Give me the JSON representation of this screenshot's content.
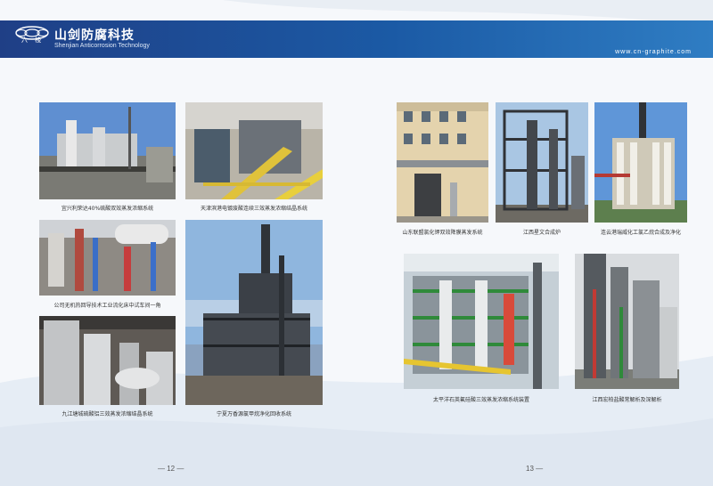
{
  "header": {
    "logo_text": "六 棱",
    "brand_cn": "山剑防腐科技",
    "brand_en": "Shenjian Anticorrosion Technology",
    "website": "www.cn-graphite.com"
  },
  "left_page": {
    "captions": [
      "宜兴利荣达40%硫酸双效蒸发浓缩系统",
      "天津滨港电镀废酸连续三效蒸发浓缩结晶系统",
      "公司无机热回导技术工业流化床中试车间一角",
      "九江塘城硫酸铝三效蒸发浓缩结晶系统",
      "宁夏万香源氯甲烷净化回收系统"
    ],
    "page_number": "— 12 —"
  },
  "right_page": {
    "captions": [
      "山东联盟氯化钾双效降膜蒸发系统",
      "江西星文合成炉",
      "连云港瑞威化工氯乙烷合成及净化",
      "太平洋石英氟硅酸三效蒸发浓缩系统装置",
      "江西宏柏盐酸常解析及深解析"
    ],
    "page_number": "13 —"
  },
  "icons": {
    "logo": "hexagon-logo-icon"
  }
}
